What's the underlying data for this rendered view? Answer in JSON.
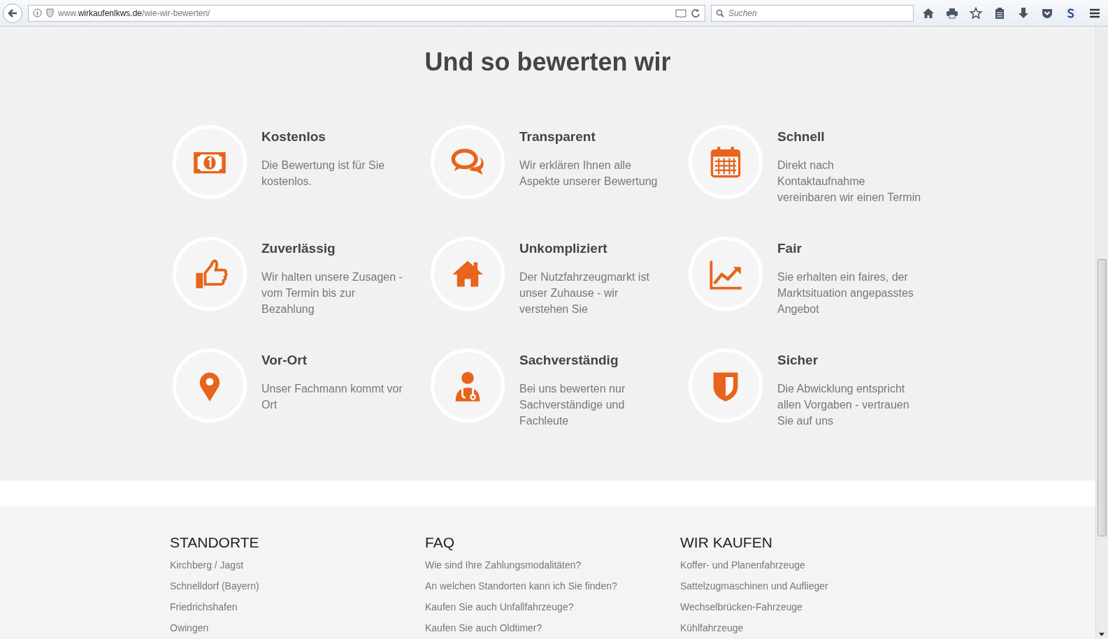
{
  "browser": {
    "url": {
      "prefix": "www.",
      "host": "wirkaufenlkws.de",
      "path": "/wie-wir-bewerten/"
    },
    "search": {
      "placeholder": "Suchen"
    }
  },
  "heading": "Und so bewerten wir",
  "features": [
    {
      "title": "Kostenlos",
      "text": "Die Bewertung ist für Sie kostenlos."
    },
    {
      "title": "Transparent",
      "text": "Wir erklären Ihnen alle Aspekte unserer Bewertung"
    },
    {
      "title": "Schnell",
      "text": "Direkt nach Kontaktaufnahme vereinbaren wir einen Termin"
    },
    {
      "title": "Zuverlässig",
      "text": "Wir halten unsere Zusagen - vom Termin bis zur Bezahlung"
    },
    {
      "title": "Unkompliziert",
      "text": "Der Nutzfahrzeugmarkt ist unser Zuhause - wir verstehen Sie"
    },
    {
      "title": "Fair",
      "text": "Sie erhalten ein faires, der Marktsituation angepasstes Angebot"
    },
    {
      "title": "Vor-Ort",
      "text": "Unser Fachmann kommt vor Ort"
    },
    {
      "title": "Sachverständig",
      "text": "Bei uns bewerten nur Sachverständige und Fachleute"
    },
    {
      "title": "Sicher",
      "text": "Die Abwicklung entspricht allen Vorgaben - vertrauen Sie auf uns"
    }
  ],
  "footer": {
    "columns": [
      {
        "title": "STANDORTE",
        "links": [
          "Kirchberg / Jagst",
          "Schnelldorf (Bayern)",
          "Friedrichshafen",
          "Owingen"
        ]
      },
      {
        "title": "FAQ",
        "links": [
          "Wie sind Ihre Zahlungsmodalitäten?",
          "An welchen Standorten kann ich Sie finden?",
          "Kaufen Sie auch Unfallfahrzeuge?",
          "Kaufen Sie auch Oldtimer?"
        ]
      },
      {
        "title": "WIR KAUFEN",
        "links": [
          "Koffer- und Planenfahrzeuge",
          "Sattelzugmaschinen und Auflieger",
          "Wechselbrücken-Fahrzeuge",
          "Kühlfahrzeuge"
        ]
      }
    ]
  }
}
